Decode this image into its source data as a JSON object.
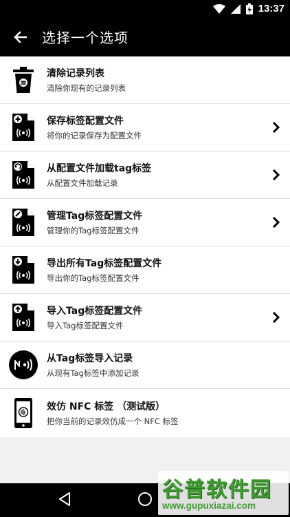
{
  "status_bar": {
    "time": "13:37"
  },
  "app_bar": {
    "title": "选择一个选项"
  },
  "items": [
    {
      "title": "清除记录列表",
      "subtitle": "清除你现有的记录列表",
      "icon": "trash-icon",
      "has_chevron": false
    },
    {
      "title": "保存标签配置文件",
      "subtitle": "将你的记录保存为配置文件",
      "icon": "save-profile-icon",
      "has_chevron": true
    },
    {
      "title": "从配置文件加载tag标签",
      "subtitle": "从配置文件加载记录",
      "icon": "load-profile-icon",
      "has_chevron": true
    },
    {
      "title": "管理Tag标签配置文件",
      "subtitle": "管理你的Tag标签配置文件",
      "icon": "manage-profile-icon",
      "has_chevron": true
    },
    {
      "title": "导出所有Tag标签配置文件",
      "subtitle": "导出你的Tag标签配置文件",
      "icon": "export-profile-icon",
      "has_chevron": false
    },
    {
      "title": "导入Tag标签配置文件",
      "subtitle": "导入Tag标签配置文件",
      "icon": "import-profile-icon",
      "has_chevron": true
    },
    {
      "title": "从Tag标签导入记录",
      "subtitle": "从现有Tag标签中添加记录",
      "icon": "nfc-tag-icon",
      "has_chevron": false
    },
    {
      "title": "效仿 NFC 标签 （测试版）",
      "subtitle": "把你当前的记录效仿成一个 NFC 标签",
      "icon": "phone-nfc-icon",
      "has_chevron": false
    }
  ],
  "watermark": {
    "text": "谷普软件园",
    "url": "www.gupuxiazai.com"
  }
}
